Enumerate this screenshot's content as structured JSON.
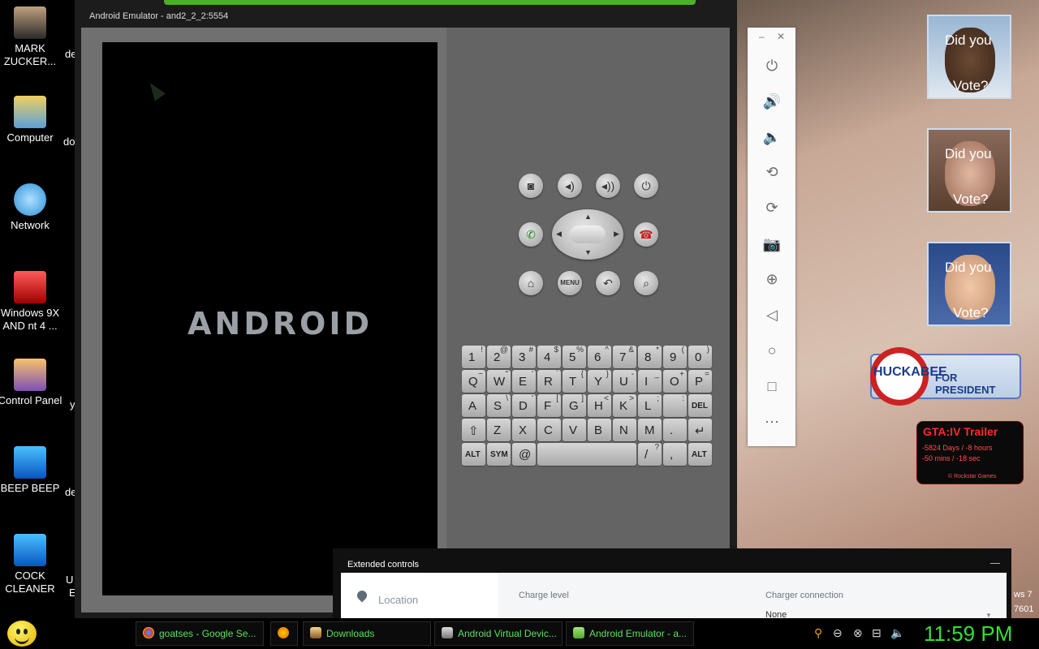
{
  "desktop": {
    "icons": [
      {
        "name": "mark-zuckerberg-icon",
        "label": "MARK ZUCKER..."
      },
      {
        "name": "computer-icon",
        "label": "Computer"
      },
      {
        "name": "network-icon",
        "label": "Network"
      },
      {
        "name": "recycle-bin-icon",
        "label": "Windows 9X AND nt 4 ..."
      },
      {
        "name": "control-panel-icon",
        "label": "Control Panel"
      },
      {
        "name": "beep-beep-icon",
        "label": "BEEP BEEP"
      },
      {
        "name": "cock-cleaner-icon",
        "label": "COCK CLEANER"
      }
    ],
    "peek_labels": [
      "de",
      "do",
      "y",
      "de",
      "U",
      "E"
    ],
    "edge_text": [
      "ws 7",
      "7601"
    ]
  },
  "emulator": {
    "title": "Android Emulator - and2_2_2:5554",
    "screen_logo": "ANDROID",
    "controls": {
      "row1": [
        "camera-icon",
        "volume-down-icon",
        "volume-up-icon",
        "power-icon"
      ],
      "call": "call-icon",
      "end_call": "end-call-icon",
      "row3": [
        "home-icon",
        "MENU",
        "back-icon",
        "search-icon"
      ]
    },
    "keyboard": [
      [
        [
          "1",
          "!"
        ],
        [
          "2",
          "@"
        ],
        [
          "3",
          "#"
        ],
        [
          "4",
          "$"
        ],
        [
          "5",
          "%"
        ],
        [
          "6",
          "^"
        ],
        [
          "7",
          "&"
        ],
        [
          "8",
          "*"
        ],
        [
          "9",
          "("
        ],
        [
          "0",
          ")"
        ]
      ],
      [
        [
          "Q",
          "~"
        ],
        [
          "W",
          "\""
        ],
        [
          "E",
          "'"
        ],
        [
          "R",
          "`"
        ],
        [
          "T",
          "{"
        ],
        [
          "Y",
          "}"
        ],
        [
          "U",
          "-"
        ],
        [
          "I",
          "_"
        ],
        [
          "O",
          "+"
        ],
        [
          "P",
          "="
        ]
      ],
      [
        [
          "A",
          ""
        ],
        [
          "S",
          "\\"
        ],
        [
          "D",
          "'"
        ],
        [
          "F",
          "["
        ],
        [
          "G",
          "]"
        ],
        [
          "H",
          "<"
        ],
        [
          "K",
          ">"
        ],
        [
          "L",
          ";"
        ],
        [
          "",
          ":"
        ],
        [
          "DEL",
          ""
        ]
      ],
      [
        [
          "⇧",
          ""
        ],
        [
          "Z",
          ""
        ],
        [
          "X",
          ""
        ],
        [
          "C",
          ""
        ],
        [
          "V",
          ""
        ],
        [
          "B",
          ""
        ],
        [
          "N",
          ""
        ],
        [
          "M",
          ""
        ],
        [
          ".",
          ""
        ],
        [
          "↵",
          ""
        ]
      ],
      [
        [
          "ALT",
          ""
        ],
        [
          "SYM",
          ""
        ],
        [
          "@",
          ""
        ],
        [
          "SPACE",
          ""
        ],
        [
          "/",
          "?"
        ],
        [
          ",",
          ""
        ],
        [
          "ALT",
          ""
        ]
      ]
    ]
  },
  "side_toolbar": {
    "minimize": "–",
    "close": "✕",
    "buttons": [
      "power-icon",
      "volume-up-icon",
      "volume-down-icon",
      "rotate-left-icon",
      "rotate-right-icon",
      "camera-icon",
      "zoom-icon",
      "back-icon",
      "home-icon",
      "overview-icon",
      "more-icon"
    ],
    "glyphs": [
      "⏻",
      "🔊",
      "🔈",
      "⟲",
      "⟳",
      "📷",
      "⊕",
      "◁",
      "○",
      "□",
      "⋯"
    ]
  },
  "gadgets": {
    "vote_question": "Did you",
    "vote_answer": "Vote?",
    "huckabee_name": "HUCKABEE",
    "huckabee_tag": "FOR PRESIDENT",
    "gta_title": "GTA:IV Trailer",
    "gta_lines": [
      "-5824 Days / -8 hours",
      "-50 mins / -18 sec",
      "© Rockstar Games"
    ]
  },
  "extended_controls": {
    "title": "Extended controls",
    "nav_item": "Location",
    "charge_level_label": "Charge level",
    "charger_connection_label": "Charger connection",
    "charger_connection_value": "None"
  },
  "taskbar": {
    "items": [
      {
        "name": "taskbar-chrome",
        "label": "goatses - Google Se...",
        "color": "#d33"
      },
      {
        "name": "taskbar-firefox",
        "label": "",
        "color": "#e66000"
      },
      {
        "name": "taskbar-downloads",
        "label": "Downloads",
        "color": "#8a5a2a"
      },
      {
        "name": "taskbar-avd",
        "label": "Android Virtual Devic...",
        "color": "#777"
      },
      {
        "name": "taskbar-emulator",
        "label": "Android Emulator - a...",
        "color": "#4caf2a"
      }
    ],
    "clock": "11:59 PM"
  },
  "colors": {
    "accent": "#4caf2a",
    "clock": "#33e033",
    "taskbar_text": "#5fe05f"
  }
}
